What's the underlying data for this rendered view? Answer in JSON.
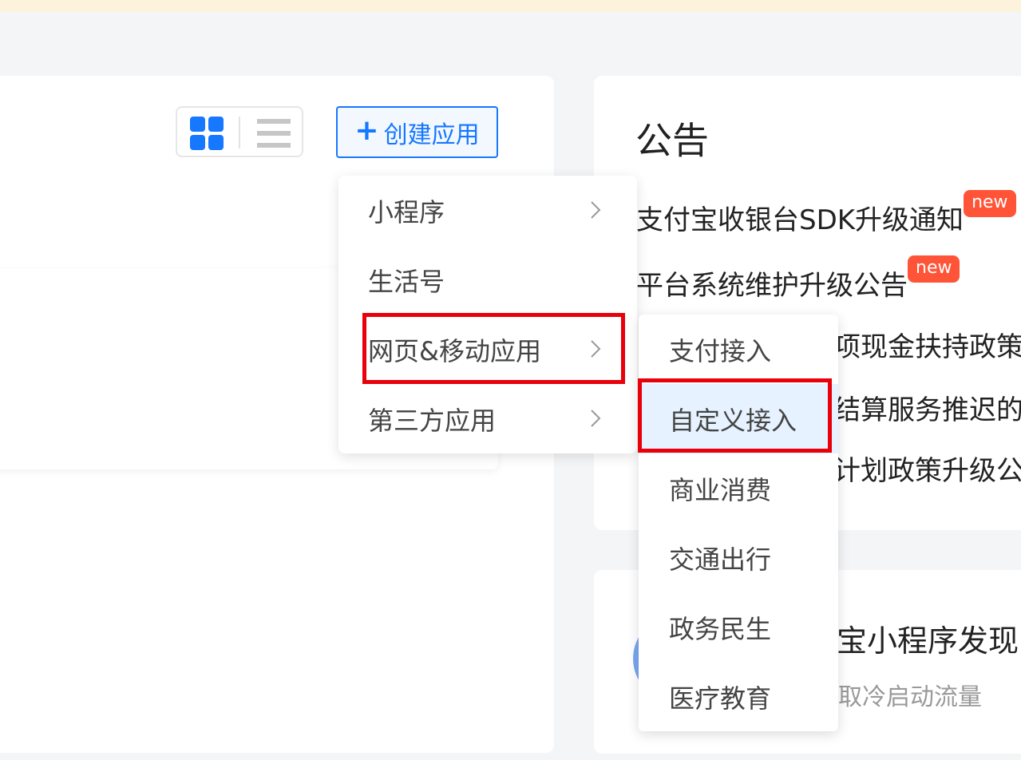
{
  "toolbar": {
    "create_button_label": "创建应用",
    "create_button_icon": "plus-icon",
    "view_modes": [
      "grid-view-icon",
      "list-view-icon"
    ],
    "active_view": "grid"
  },
  "notice": {
    "title": "公告",
    "items": [
      {
        "text": "支付宝收银台SDK升级通知",
        "badge": "new"
      },
      {
        "text": "平台系统维护升级公告",
        "badge": "new"
      },
      {
        "text": "项现金扶持政策"
      },
      {
        "text": "结算服务推迟的"
      },
      {
        "text": "计划政策升级公"
      }
    ]
  },
  "promo": {
    "title": "宝小程序发现",
    "subtitle": "取冷启动流量"
  },
  "menu": {
    "items": [
      {
        "label": "小程序",
        "has_submenu": true
      },
      {
        "label": "生活号",
        "has_submenu": false
      },
      {
        "label": "网页&移动应用",
        "has_submenu": true,
        "highlighted": true
      },
      {
        "label": "第三方应用",
        "has_submenu": true
      }
    ]
  },
  "submenu": {
    "items": [
      {
        "label": "支付接入"
      },
      {
        "label": "自定义接入",
        "active": true,
        "highlighted": true
      },
      {
        "label": "商业消费"
      },
      {
        "label": "交通出行"
      },
      {
        "label": "政务民生"
      },
      {
        "label": "医疗教育"
      }
    ]
  },
  "colors": {
    "primary": "#1677ff",
    "badge": "#ff5437",
    "highlight_border": "#e8000b",
    "active_item_bg": "#e6f2ff"
  }
}
